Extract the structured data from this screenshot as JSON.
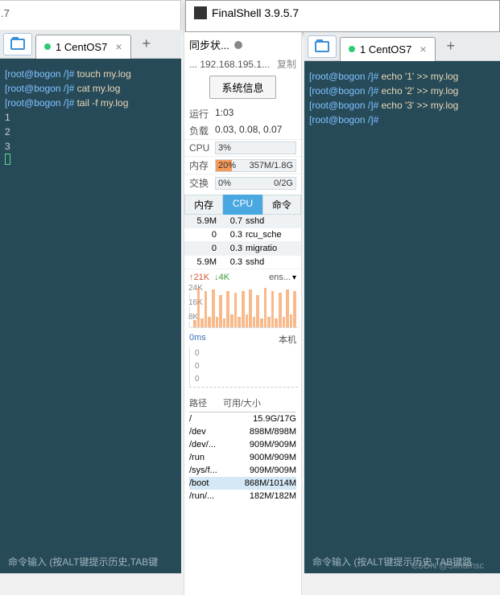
{
  "bg_title_fragment": ".7",
  "app": {
    "title": "FinalShell 3.9.5.7"
  },
  "tabs": {
    "left": {
      "label": "1 CentOS7"
    },
    "right": {
      "label": "1 CentOS7"
    },
    "add": "+"
  },
  "terminal_left": {
    "prompt": "[root@bogon /]#",
    "lines": [
      {
        "cmd": "touch my.log"
      },
      {
        "cmd": "cat my.log"
      },
      {
        "cmd": "tail -f my.log"
      }
    ],
    "output": [
      "1",
      "2",
      "3"
    ],
    "hint": "命令输入 (按ALT键提示历史,TAB键"
  },
  "terminal_right": {
    "prompt": "[root@bogon /]#",
    "lines": [
      {
        "cmd": "echo '1' >> my.log"
      },
      {
        "cmd": "echo '2' >> my.log"
      },
      {
        "cmd": "echo '3' >> my.log"
      }
    ],
    "hint": "命令输入 (按ALT键提示历史,TAB键路"
  },
  "panel": {
    "sync": "同步状...",
    "ip": "... 192.168.195.1...",
    "copy": "复制",
    "sysinfo": "系统信息",
    "uptime_lbl": "运行",
    "uptime_val": "1:03",
    "load_lbl": "负载",
    "load_val": "0.03, 0.08, 0.07",
    "cpu_lbl": "CPU",
    "cpu_pct": "3%",
    "cpu_fill": "3%",
    "mem_lbl": "内存",
    "mem_pct": "20%",
    "mem_txt": "357M/1.8G",
    "mem_fill": "20%",
    "swap_lbl": "交换",
    "swap_pct": "0%",
    "swap_txt": "0/2G",
    "swap_fill": "0%",
    "proc_tabs": [
      "内存",
      "CPU",
      "命令"
    ],
    "procs": [
      {
        "mem": "5.9M",
        "cpu": "0.7",
        "cmd": "sshd"
      },
      {
        "mem": "0",
        "cpu": "0.3",
        "cmd": "rcu_sche"
      },
      {
        "mem": "0",
        "cpu": "0.3",
        "cmd": "migratio"
      },
      {
        "mem": "5.9M",
        "cpu": "0.3",
        "cmd": "sshd"
      }
    ],
    "net": {
      "up": "↑21K",
      "down": "↓4K",
      "iface": "ens..."
    },
    "yticks": [
      "24K",
      "16K",
      "8K"
    ],
    "ping": {
      "val": "0ms",
      "host": "本机"
    },
    "ping_zeros": [
      "0",
      "0",
      "0"
    ],
    "disk": {
      "h1": "路径",
      "h2": "可用/大小",
      "rows": [
        {
          "path": "/",
          "val": "15.9G/17G"
        },
        {
          "path": "/dev",
          "val": "898M/898M"
        },
        {
          "path": "/dev/...",
          "val": "909M/909M"
        },
        {
          "path": "/run",
          "val": "900M/909M"
        },
        {
          "path": "/sys/f...",
          "val": "909M/909M"
        },
        {
          "path": "/boot",
          "val": "868M/1014M"
        },
        {
          "path": "/run/...",
          "val": "182M/182M"
        }
      ]
    }
  },
  "watermark": "CSDN @Siinamsc",
  "chart_data": {
    "type": "bar",
    "title": "",
    "ylabel": "",
    "ylim": [
      0,
      24
    ],
    "yticks": [
      8,
      16,
      24
    ],
    "x": [
      1,
      2,
      3,
      4,
      5,
      6,
      7,
      8,
      9,
      10,
      11,
      12,
      13,
      14,
      15,
      16,
      17,
      18,
      19,
      20,
      21,
      22,
      23,
      24,
      25,
      26,
      27,
      28
    ],
    "series": [
      {
        "name": "up_K",
        "values": [
          4,
          22,
          5,
          20,
          6,
          21,
          6,
          18,
          5,
          20,
          7,
          19,
          6,
          20,
          7,
          21,
          6,
          18,
          5,
          22,
          6,
          20,
          5,
          19,
          6,
          21,
          7,
          20
        ]
      }
    ]
  }
}
